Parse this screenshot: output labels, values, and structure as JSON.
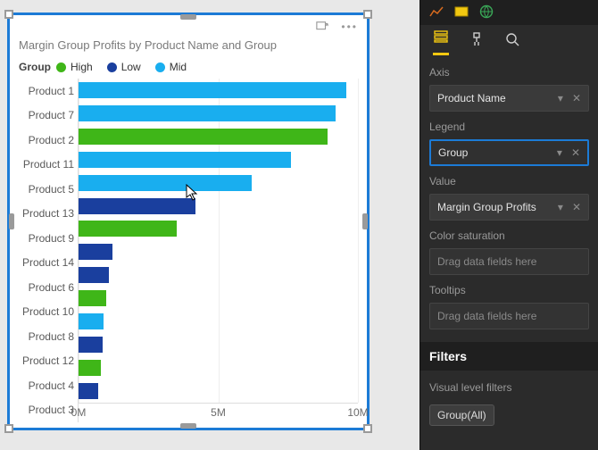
{
  "chart_data": {
    "type": "bar",
    "orientation": "horizontal",
    "title": "Margin Group Profits by Product Name and Group",
    "xlabel": "",
    "ylabel": "",
    "xlim": [
      0,
      10
    ],
    "x_unit": "M",
    "x_ticks": [
      0,
      5,
      10
    ],
    "legend_title": "Group",
    "series_colors": {
      "High": "#3fb618",
      "Low": "#1a3f9e",
      "Mid": "#19aeef"
    },
    "categories": [
      "Product 1",
      "Product 7",
      "Product 2",
      "Product 11",
      "Product 5",
      "Product 13",
      "Product 9",
      "Product 14",
      "Product 6",
      "Product 10",
      "Product 8",
      "Product 12",
      "Product 4",
      "Product 3"
    ],
    "group": [
      "Mid",
      "Mid",
      "High",
      "Mid",
      "Mid",
      "Low",
      "High",
      "Low",
      "Low",
      "High",
      "Mid",
      "Low",
      "High",
      "Low"
    ],
    "values": [
      9.6,
      9.2,
      8.9,
      7.6,
      6.2,
      4.2,
      3.5,
      1.2,
      1.1,
      1.0,
      0.9,
      0.85,
      0.8,
      0.7
    ]
  },
  "legend": {
    "title": "Group",
    "items": [
      {
        "label": "High",
        "color": "#3fb618"
      },
      {
        "label": "Low",
        "color": "#1a3f9e"
      },
      {
        "label": "Mid",
        "color": "#19aeef"
      }
    ]
  },
  "x_ticks": [
    {
      "label": "0M",
      "frac": 0.0
    },
    {
      "label": "5M",
      "frac": 0.5
    },
    {
      "label": "10M",
      "frac": 1.0
    }
  ],
  "props": {
    "sections": {
      "axis": {
        "label": "Axis",
        "value": "Product Name"
      },
      "legend": {
        "label": "Legend",
        "value": "Group"
      },
      "value": {
        "label": "Value",
        "value": "Margin Group Profits"
      },
      "color_sat": {
        "label": "Color saturation",
        "placeholder": "Drag data fields here"
      },
      "tooltips": {
        "label": "Tooltips",
        "placeholder": "Drag data fields here"
      }
    },
    "filters": {
      "header": "Filters",
      "sub": "Visual level filters",
      "chip": "Group(All)"
    }
  }
}
